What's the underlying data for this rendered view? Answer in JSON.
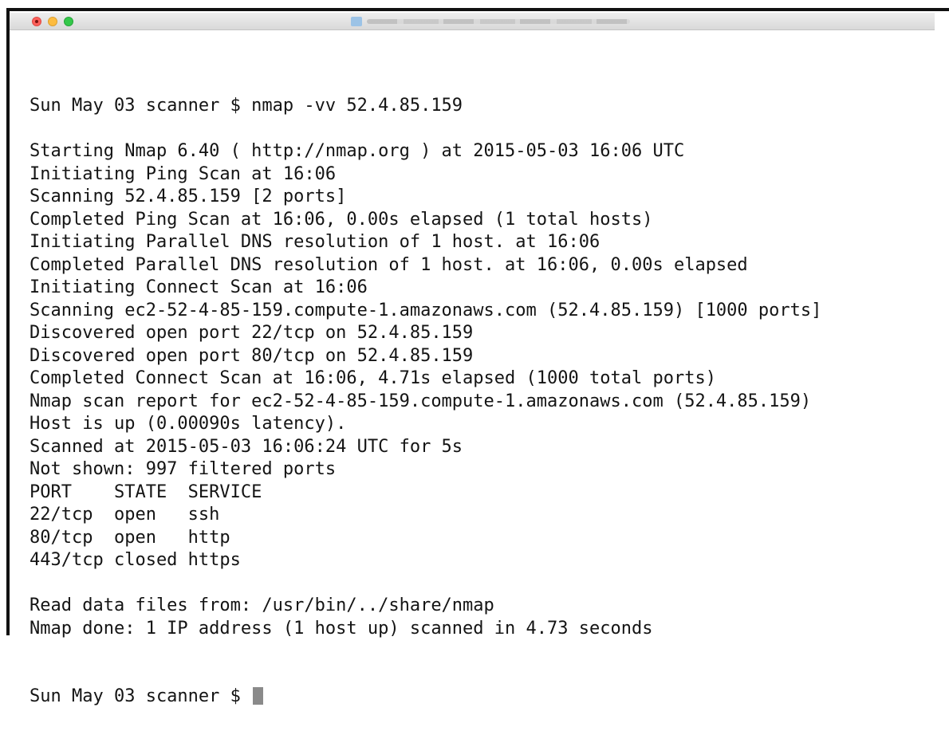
{
  "window": {
    "title_blurred": true
  },
  "terminal": {
    "lines": [
      "Sun May 03 scanner $ nmap -vv 52.4.85.159",
      "",
      "Starting Nmap 6.40 ( http://nmap.org ) at 2015-05-03 16:06 UTC",
      "Initiating Ping Scan at 16:06",
      "Scanning 52.4.85.159 [2 ports]",
      "Completed Ping Scan at 16:06, 0.00s elapsed (1 total hosts)",
      "Initiating Parallel DNS resolution of 1 host. at 16:06",
      "Completed Parallel DNS resolution of 1 host. at 16:06, 0.00s elapsed",
      "Initiating Connect Scan at 16:06",
      "Scanning ec2-52-4-85-159.compute-1.amazonaws.com (52.4.85.159) [1000 ports]",
      "Discovered open port 22/tcp on 52.4.85.159",
      "Discovered open port 80/tcp on 52.4.85.159",
      "Completed Connect Scan at 16:06, 4.71s elapsed (1000 total ports)",
      "Nmap scan report for ec2-52-4-85-159.compute-1.amazonaws.com (52.4.85.159)",
      "Host is up (0.00090s latency).",
      "Scanned at 2015-05-03 16:06:24 UTC for 5s",
      "Not shown: 997 filtered ports",
      "PORT    STATE  SERVICE",
      "22/tcp  open   ssh",
      "80/tcp  open   http",
      "443/tcp closed https",
      "",
      "Read data files from: /usr/bin/../share/nmap",
      "Nmap done: 1 IP address (1 host up) scanned in 4.73 seconds"
    ],
    "prompt": "Sun May 03 scanner $ "
  },
  "colors": {
    "text": "#141414",
    "cursor": "#8a8a8a",
    "close": "#fc605b",
    "minimize": "#fdbc40",
    "maximize": "#34c84a"
  }
}
